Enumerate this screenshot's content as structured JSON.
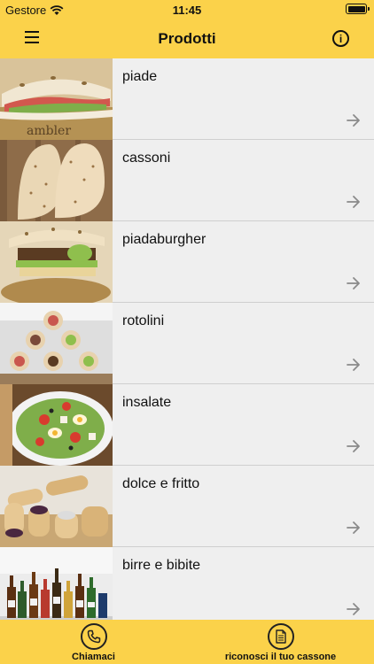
{
  "status": {
    "carrier": "Gestore",
    "time": "11:45"
  },
  "nav": {
    "title": "Prodotti"
  },
  "items": [
    {
      "label": "piade"
    },
    {
      "label": "cassoni"
    },
    {
      "label": "piadaburgher"
    },
    {
      "label": "rotolini"
    },
    {
      "label": "insalate"
    },
    {
      "label": "dolce e fritto"
    },
    {
      "label": "birre e bibite"
    }
  ],
  "tabs": [
    {
      "label": "Chiamaci",
      "icon": "phone-icon"
    },
    {
      "label": "riconosci il tuo cassone",
      "icon": "document-icon"
    }
  ],
  "colors": {
    "accent": "#fbd24a"
  }
}
